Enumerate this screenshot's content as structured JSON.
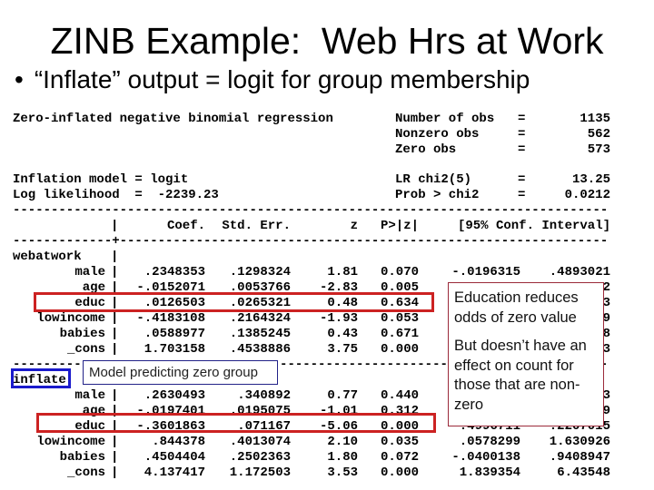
{
  "slide": {
    "title": "ZINB Example:  Web Hrs at Work",
    "bullet": "“Inflate” output = logit for group membership"
  },
  "summary": {
    "model_title": "Zero-inflated negative binomial regression",
    "inflation_model": "Inflation model = logit",
    "log_likelihood": "Log likelihood  =  -2239.23",
    "stats": [
      {
        "label": "Number of obs",
        "eq": "=",
        "value": "1135"
      },
      {
        "label": "Nonzero obs",
        "eq": "=",
        "value": "562"
      },
      {
        "label": "Zero obs",
        "eq": "=",
        "value": "573"
      },
      {
        "label": "LR chi2(5)",
        "eq": "=",
        "value": "13.25"
      },
      {
        "label": "Prob > chi2",
        "eq": "=",
        "value": "0.0212"
      }
    ]
  },
  "table": {
    "rule": "------------------------------------------------------------------------------",
    "rule_plus": "-------------+----------------------------------------------------------------",
    "headers": [
      "Coef.",
      "Std. Err.",
      "z",
      "P>|z|",
      "[95% Conf. Interval]"
    ],
    "groups": [
      {
        "name": "webatwork",
        "rows": [
          {
            "var": "male",
            "coef": ".2348353",
            "se": ".1298324",
            "z": "1.81",
            "p": "0.070",
            "ci_lo": "-.0196315",
            "ci_hi": ".4893021"
          },
          {
            "var": "age",
            "coef": "-.0152071",
            "se": ".0053766",
            "z": "-2.83",
            "p": "0.005",
            "ci_lo": "",
            "ci_hi": "2"
          },
          {
            "var": "educ",
            "coef": ".0126503",
            "se": ".0265321",
            "z": "0.48",
            "p": "0.634",
            "ci_lo": "",
            "ci_hi": "3"
          },
          {
            "var": "lowincome",
            "coef": "-.4183108",
            "se": ".2164324",
            "z": "-1.93",
            "p": "0.053",
            "ci_lo": "",
            "ci_hi": "9"
          },
          {
            "var": "babies",
            "coef": ".0588977",
            "se": ".1385245",
            "z": "0.43",
            "p": "0.671",
            "ci_lo": "",
            "ci_hi": "8"
          },
          {
            "var": "_cons",
            "coef": "1.703158",
            "se": ".4538886",
            "z": "3.75",
            "p": "0.000",
            "ci_lo": "",
            "ci_hi": "3"
          }
        ]
      },
      {
        "name": "inflate",
        "rows": [
          {
            "var": "male",
            "coef": ".2630493",
            "se": ".340892",
            "z": "0.77",
            "p": "0.440",
            "ci_lo": "",
            "ci_hi": "3"
          },
          {
            "var": "age",
            "coef": "-.0197401",
            "se": ".0195075",
            "z": "-1.01",
            "p": "0.312",
            "ci_lo": "",
            "ci_hi": "9"
          },
          {
            "var": "educ",
            "coef": "-.3601863",
            "se": ".071167",
            "z": "-5.06",
            "p": "0.000",
            "ci_lo": "-.4996711",
            "ci_hi": "-.2207015"
          },
          {
            "var": "lowincome",
            "coef": ".844378",
            "se": ".4013074",
            "z": "2.10",
            "p": "0.035",
            "ci_lo": ".0578299",
            "ci_hi": "1.630926"
          },
          {
            "var": "babies",
            "coef": ".4504404",
            "se": ".2502363",
            "z": "1.80",
            "p": "0.072",
            "ci_lo": "-.0400138",
            "ci_hi": ".9408947"
          },
          {
            "var": "_cons",
            "coef": "4.137417",
            "se": "1.172503",
            "z": "3.53",
            "p": "0.000",
            "ci_lo": "1.839354",
            "ci_hi": "6.43548"
          }
        ]
      }
    ]
  },
  "annotations": {
    "zero_group": "Model predicting zero group",
    "education_note_1": "Education reduces odds of zero value",
    "education_note_2": "But doesn’t have an effect on count for those that are non-zero"
  },
  "colors": {
    "highlight_red": "#cc2222",
    "highlight_blue": "#1a1acc",
    "callout_border": "#9b2a3a",
    "callout_border_blue": "#222288"
  }
}
